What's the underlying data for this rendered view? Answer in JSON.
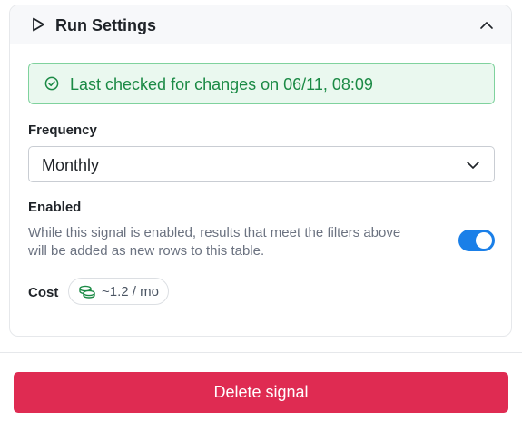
{
  "run_settings": {
    "title": "Run Settings",
    "collapse_icon": "chevron-up-icon",
    "play_icon": "play-icon"
  },
  "status": {
    "message": "Last checked for changes on 06/11, 08:09",
    "icon": "check-circle-icon",
    "color": "#1b8a45",
    "background": "#eaf8ef",
    "border": "#7fd29d"
  },
  "frequency": {
    "label": "Frequency",
    "selected": "Monthly",
    "dropdown_icon": "chevron-down-icon"
  },
  "enabled": {
    "label": "Enabled",
    "description": "While this signal is enabled, results that meet the filters above will be added as new rows to this table.",
    "is_on": true,
    "toggle_color": "#1a7fe8"
  },
  "cost": {
    "label": "Cost",
    "value": "~1.2 / mo",
    "icon": "coins-icon",
    "icon_color": "#1b8a45"
  },
  "actions": {
    "delete_label": "Delete signal",
    "delete_color": "#df2b52"
  }
}
